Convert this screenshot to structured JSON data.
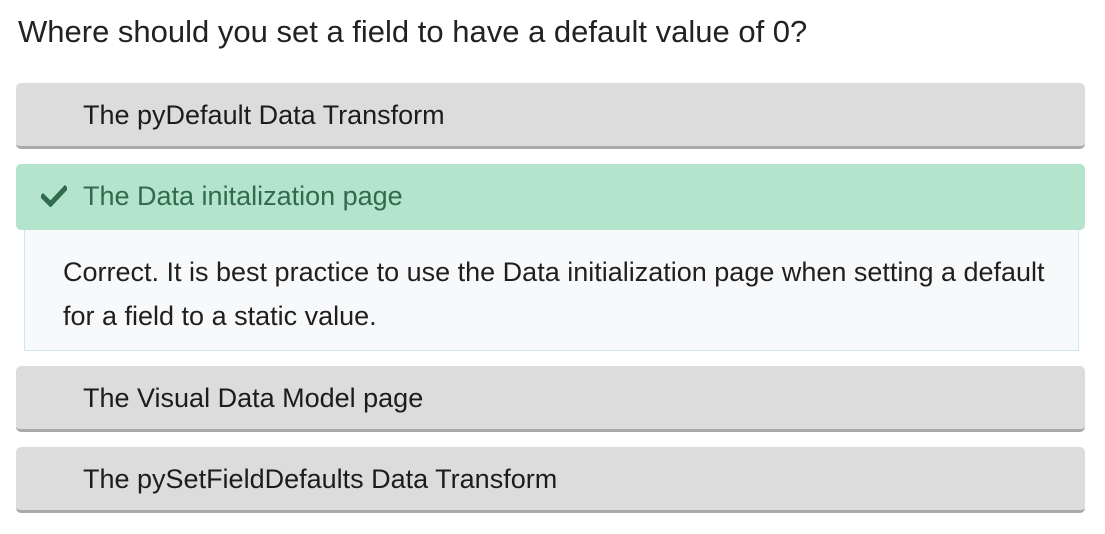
{
  "question": {
    "text": "Where should you set a field to have a default value of 0?"
  },
  "options": [
    {
      "label": "The pyDefault Data Transform",
      "state": "unselected"
    },
    {
      "label": "The Data initalization page",
      "state": "correct",
      "icon": "checkmark-icon"
    },
    {
      "label": "The Visual Data Model page",
      "state": "unselected"
    },
    {
      "label": "The pySetFieldDefaults Data Transform",
      "state": "unselected"
    }
  ],
  "feedback": {
    "text": "Correct. It is best practice to use the Data initialization page when setting a default for a field to a static value."
  },
  "colors": {
    "option_bg": "#dcdcdc",
    "correct_bg": "#b4e4cc",
    "correct_text": "#2f6b4c",
    "feedback_bg": "#f8f9fa"
  }
}
